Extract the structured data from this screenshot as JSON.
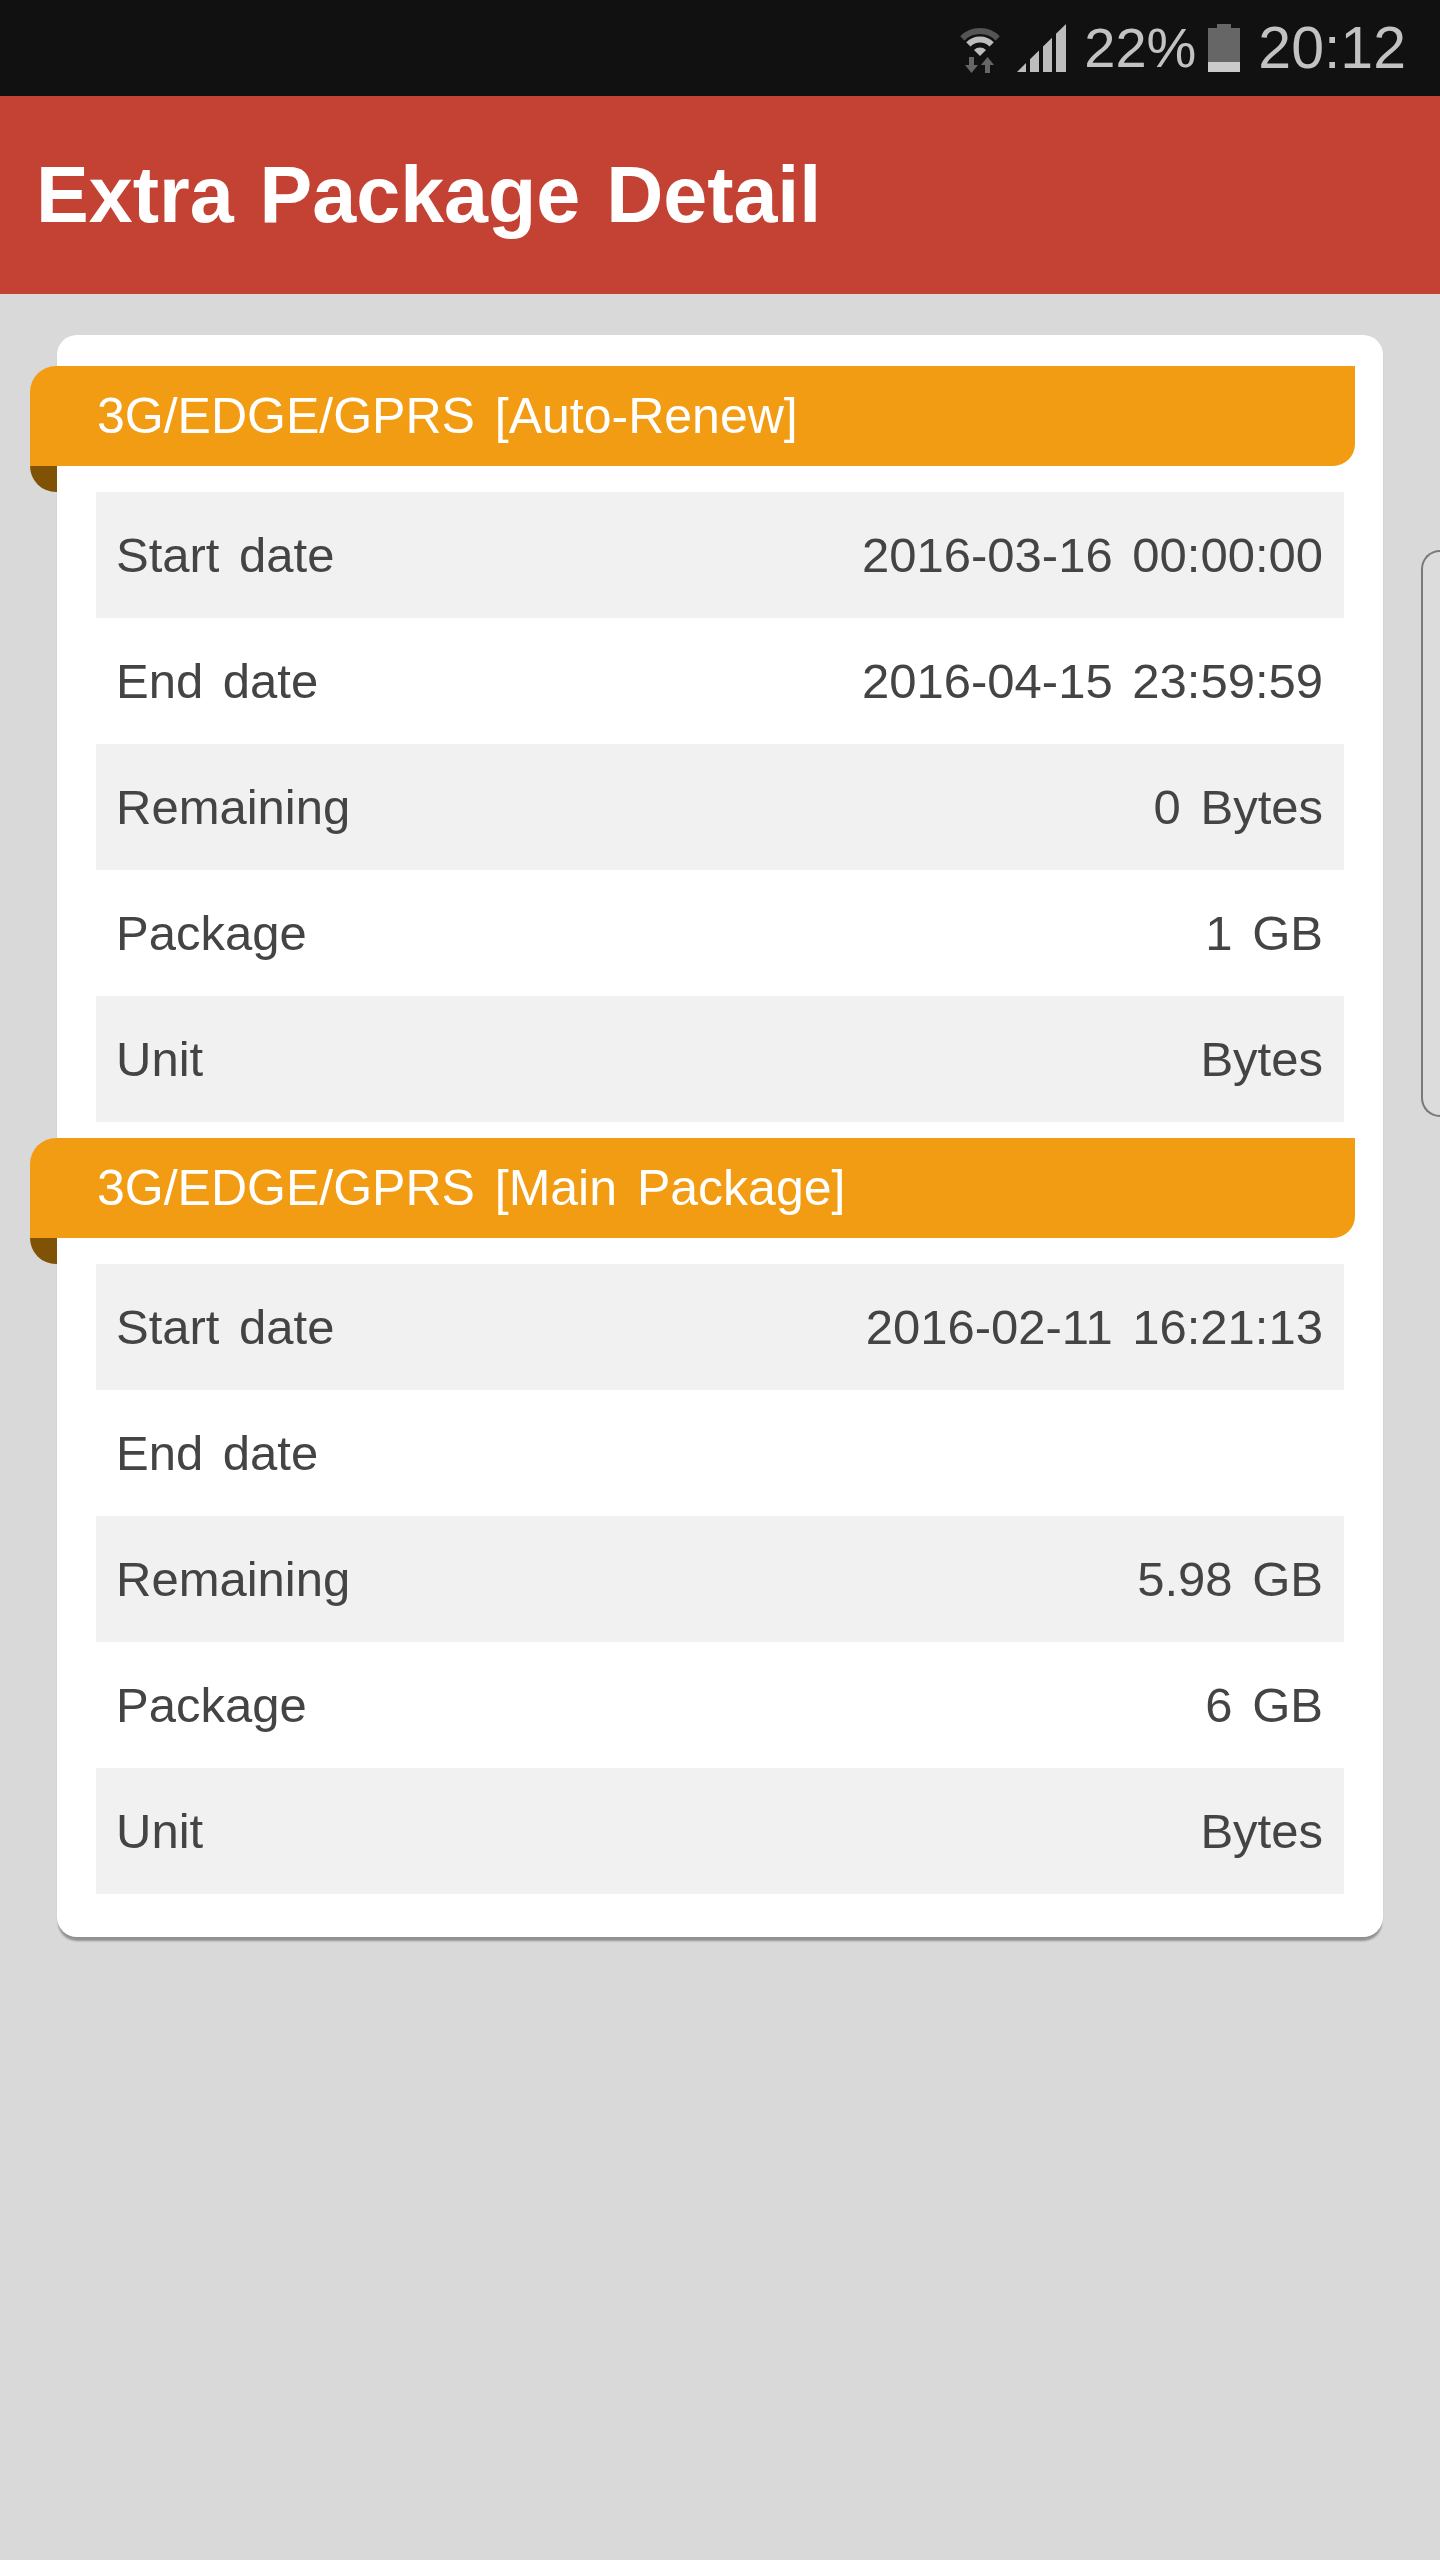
{
  "status_bar": {
    "battery": "22%",
    "time": "20:12"
  },
  "app_bar": {
    "title": "Extra Package Detail"
  },
  "packages": [
    {
      "title": "3G/EDGE/GPRS [Auto-Renew]",
      "rows": [
        {
          "label": "Start date",
          "value": "2016-03-16 00:00:00"
        },
        {
          "label": "End date",
          "value": "2016-04-15 23:59:59"
        },
        {
          "label": "Remaining",
          "value": "0 Bytes"
        },
        {
          "label": "Package",
          "value": "1 GB"
        },
        {
          "label": "Unit",
          "value": "Bytes"
        }
      ]
    },
    {
      "title": "3G/EDGE/GPRS [Main Package]",
      "rows": [
        {
          "label": "Start date",
          "value": "2016-02-11 16:21:13"
        },
        {
          "label": "End date"
        },
        {
          "label": "Remaining",
          "value": "5.98 GB"
        },
        {
          "label": "Package",
          "value": "6 GB"
        },
        {
          "label": "Unit",
          "value": "Bytes"
        }
      ]
    }
  ]
}
